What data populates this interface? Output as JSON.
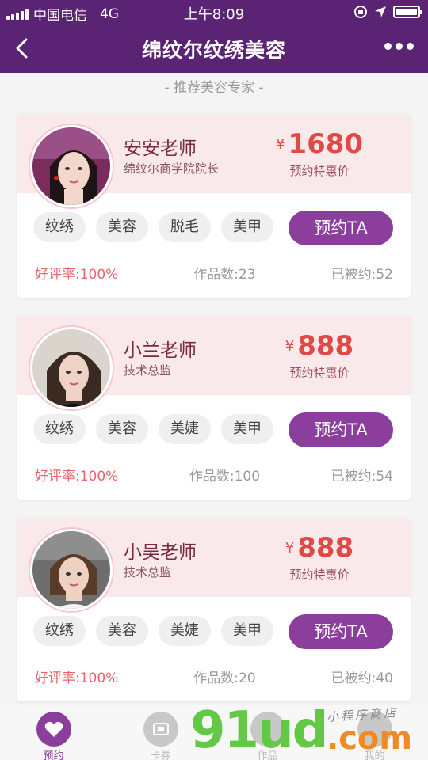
{
  "status_bar": {
    "carrier": "中国电信",
    "network": "4G",
    "time": "上午8:09"
  },
  "nav": {
    "title": "绵纹尔纹绣美容",
    "back_icon": "chevron-left-icon",
    "more_icon": "more-dots-icon"
  },
  "section_title": "- 推荐美容专家 -",
  "experts": [
    {
      "name": "安安老师",
      "role": "绵纹尔商学院院长",
      "currency": "¥",
      "price": "1680",
      "price_label": "预约特惠价",
      "tags": [
        "纹绣",
        "美容",
        "脱毛",
        "美甲"
      ],
      "book_label": "预约TA",
      "rating": "好评率:100%",
      "works": "作品数:23",
      "booked": "已被约:52"
    },
    {
      "name": "小兰老师",
      "role": "技术总监",
      "currency": "¥",
      "price": "888",
      "price_label": "预约特惠价",
      "tags": [
        "纹绣",
        "美容",
        "美婕",
        "美甲"
      ],
      "book_label": "预约TA",
      "rating": "好评率:100%",
      "works": "作品数:100",
      "booked": "已被约:54"
    },
    {
      "name": "小吴老师",
      "role": "技术总监",
      "currency": "¥",
      "price": "888",
      "price_label": "预约特惠价",
      "tags": [
        "纹绣",
        "美容",
        "美婕",
        "美甲"
      ],
      "book_label": "预约TA",
      "rating": "好评率:100%",
      "works": "作品数:20",
      "booked": "已被约:40"
    }
  ],
  "tabbar": {
    "items": [
      {
        "label": "预约",
        "icon": "heart-icon"
      },
      {
        "label": "卡券",
        "icon": "card-icon"
      },
      {
        "label": "作品",
        "icon": "works-icon"
      },
      {
        "label": "我的",
        "icon": "user-icon"
      }
    ]
  },
  "watermark": {
    "num": "91ud",
    "com": ".com",
    "small": "小程序商店"
  },
  "colors": {
    "brand": "#5a2374",
    "accent": "#8b3e9c",
    "price": "#e04a46",
    "card_head": "#fae9eb"
  }
}
